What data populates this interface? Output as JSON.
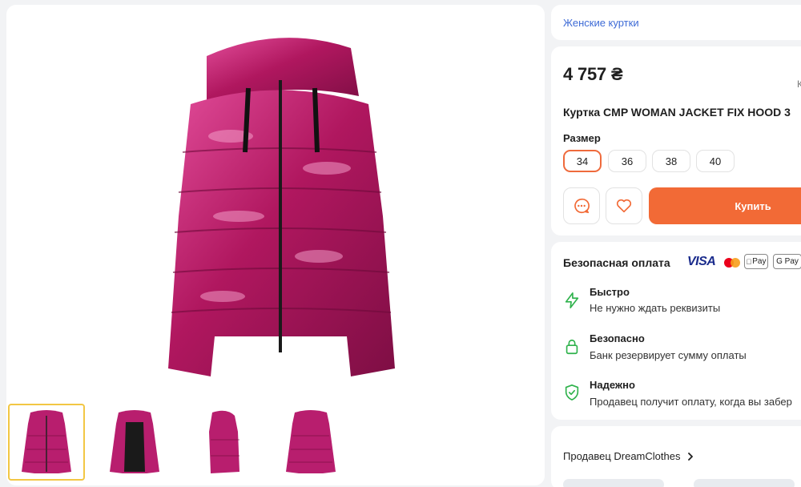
{
  "breadcrumb": {
    "category": "Женские куртки"
  },
  "product": {
    "price": "4 757 ₴",
    "corner_mark": "К",
    "title": "Куртка CMP WOMAN JACKET FIX HOOD 3",
    "size_label": "Размер",
    "sizes": [
      "34",
      "36",
      "38",
      "40"
    ],
    "selected_size": "34",
    "buy_label": "Купить"
  },
  "payment": {
    "title": "Безопасная оплата",
    "logos": {
      "visa": "VISA",
      "applepay": "Pay",
      "gpay": "G Pay"
    },
    "features": [
      {
        "title": "Быстро",
        "text": "Не нужно ждать реквизиты",
        "icon": "lightning-icon"
      },
      {
        "title": "Безопасно",
        "text": "Банк резервирует сумму оплаты",
        "icon": "lock-icon"
      },
      {
        "title": "Надежно",
        "text": "Продавец получит оплату, когда вы забер",
        "icon": "shield-check-icon"
      }
    ]
  },
  "seller": {
    "label": "Продавец DreamClothes"
  },
  "colors": {
    "accent": "#f26a36",
    "link": "#3e6bd6",
    "success": "#2fb24c",
    "jacket": "#b81e6e"
  }
}
